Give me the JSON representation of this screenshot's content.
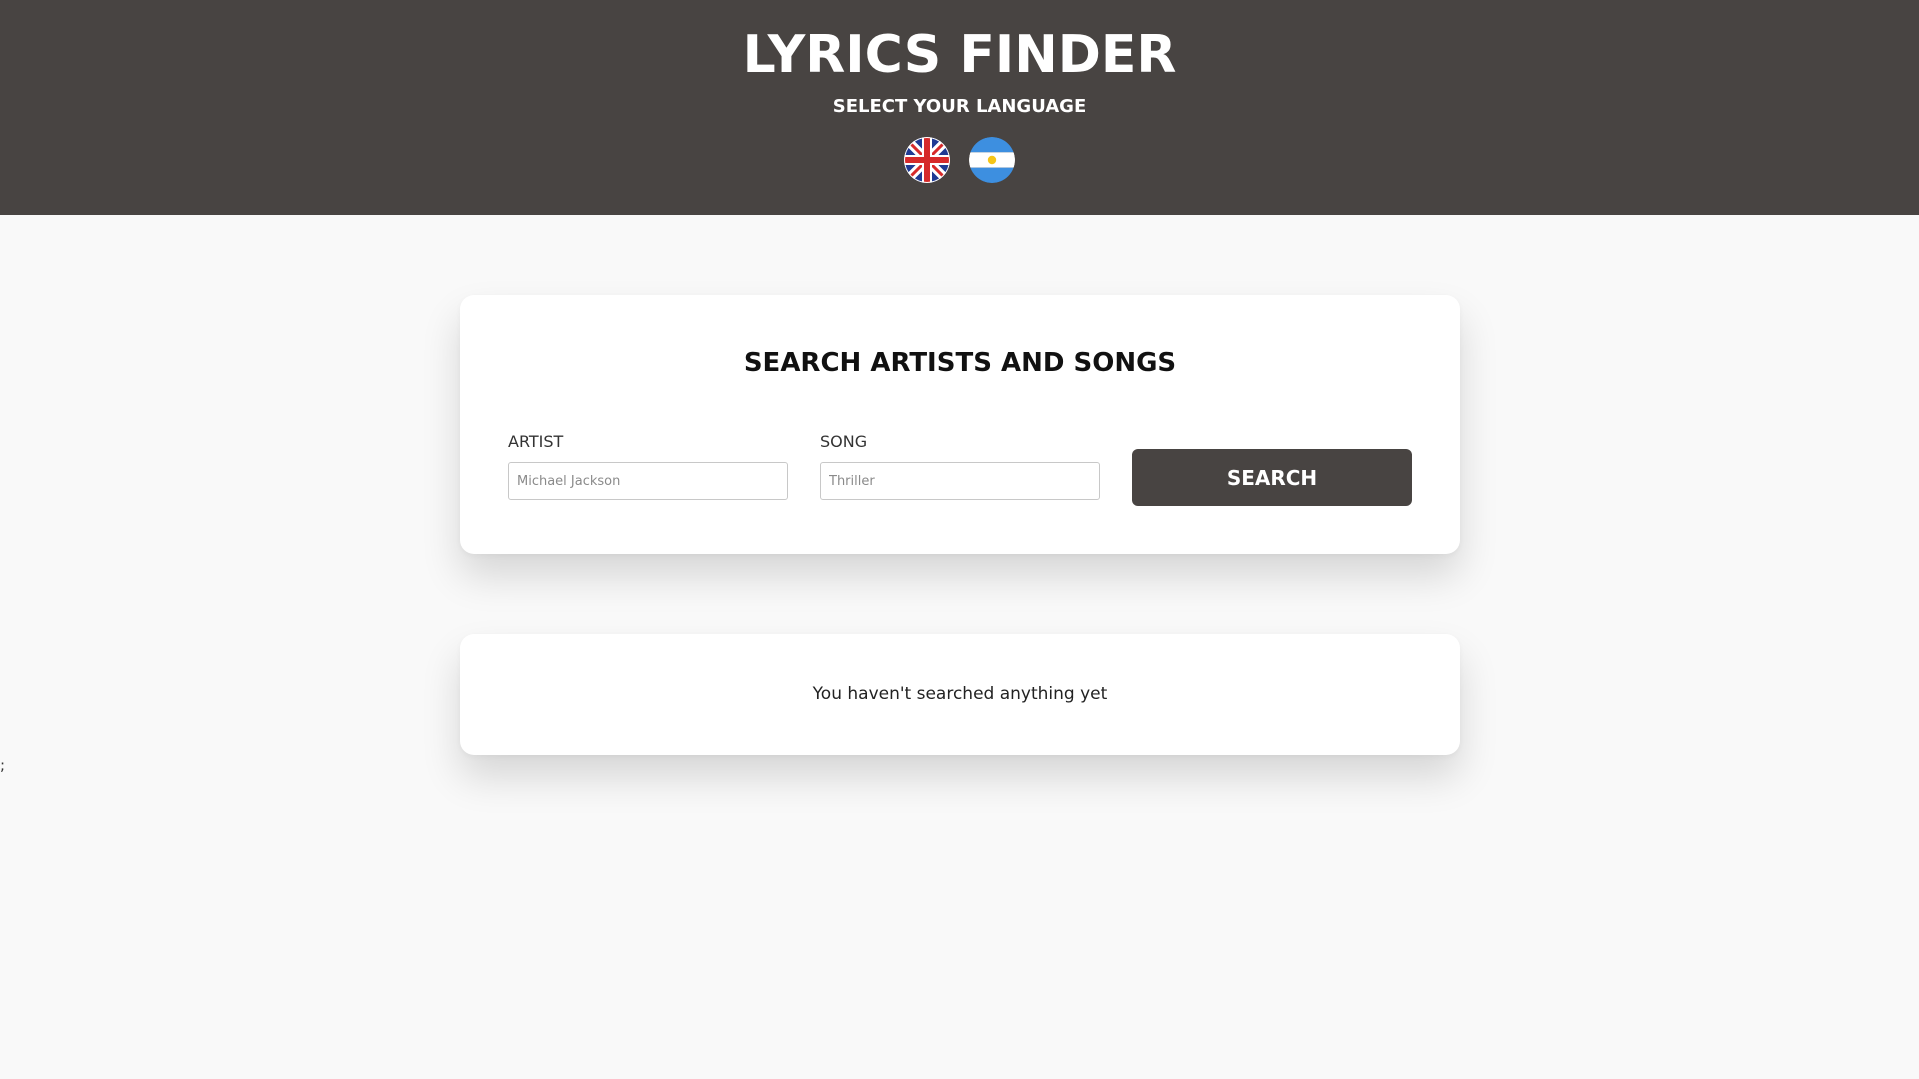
{
  "header": {
    "title": "LYRICS FINDER",
    "subtitle": "SELECT YOUR LANGUAGE",
    "languages": [
      {
        "name": "English",
        "icon": "uk-flag-icon"
      },
      {
        "name": "Spanish",
        "icon": "argentina-flag-icon"
      }
    ],
    "background_color": "#484442"
  },
  "search_card": {
    "title": "SEARCH ARTISTS AND SONGS",
    "artist_label": "ARTIST",
    "artist_placeholder": "Michael Jackson",
    "artist_value": "",
    "song_label": "SONG",
    "song_placeholder": "Thriller",
    "song_value": "",
    "search_button_label": "SEARCH",
    "button_color": "#484442"
  },
  "results_card": {
    "empty_message": "You haven't searched anything yet"
  },
  "stray_text": ";"
}
